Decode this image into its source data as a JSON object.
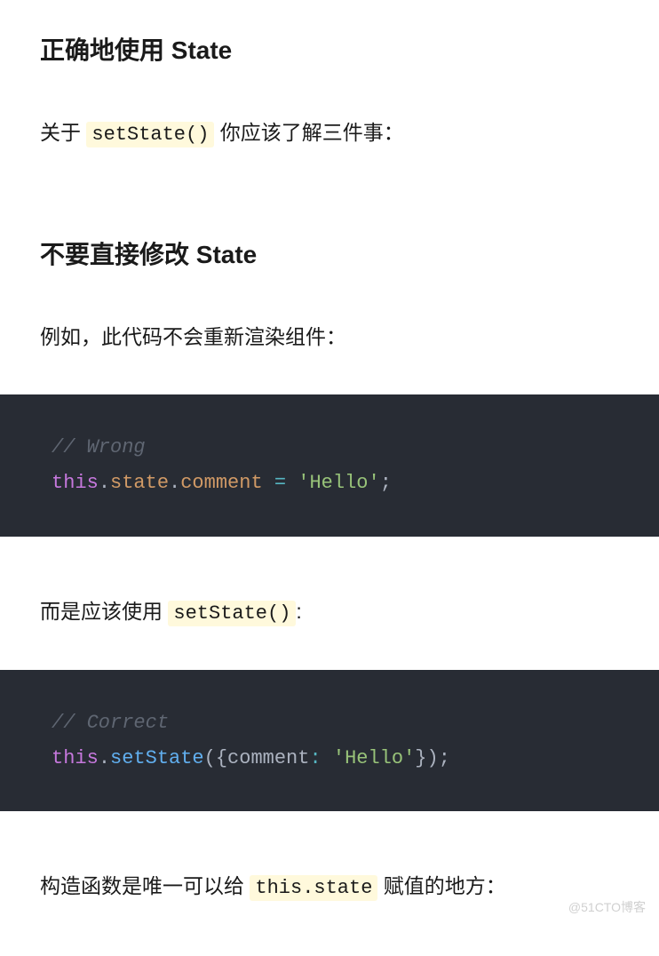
{
  "heading1": "正确地使用 State",
  "para1_before": "关于 ",
  "para1_code": "setState()",
  "para1_after": " 你应该了解三件事：",
  "heading2": "不要直接修改 State",
  "para2": "例如，此代码不会重新渲染组件：",
  "code1": {
    "comment": "// Wrong",
    "l2_kw": "this",
    "l2_dot1": ".",
    "l2_state": "state",
    "l2_dot2": ".",
    "l2_comment": "comment",
    "l2_sp1": " ",
    "l2_eq": "=",
    "l2_sp2": " ",
    "l2_str": "'Hello'",
    "l2_semi": ";"
  },
  "para3_before": "而是应该使用 ",
  "para3_code": "setState()",
  "para3_after": ":",
  "code2": {
    "comment": "// Correct",
    "l2_kw": "this",
    "l2_dot1": ".",
    "l2_method": "setState",
    "l2_paren1": "(",
    "l2_brace1": "{",
    "l2_key": "comment",
    "l2_colon": ":",
    "l2_sp": " ",
    "l2_str": "'Hello'",
    "l2_brace2": "}",
    "l2_paren2": ")",
    "l2_semi": ";"
  },
  "para4_before": "构造函数是唯一可以给 ",
  "para4_code": "this.state",
  "para4_after": " 赋值的地方：",
  "watermark": "@51CTO博客"
}
